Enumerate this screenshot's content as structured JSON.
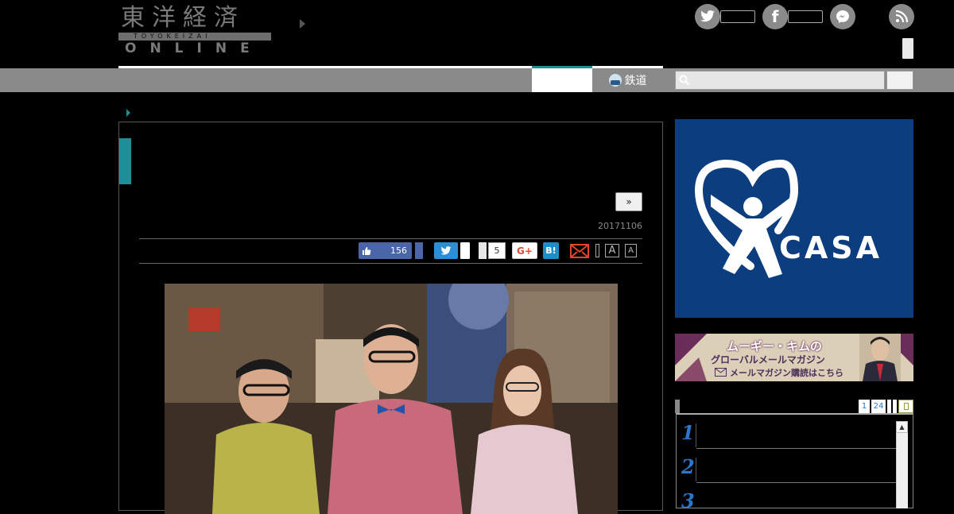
{
  "header": {
    "logo_kanji": "東洋経済",
    "logo_romaji": "TOYOKEIZAI",
    "logo_online": "ONLINE"
  },
  "social": {
    "icons": [
      "twitter-icon",
      "facebook-icon",
      "messenger-icon",
      "rss-icon"
    ],
    "twitter_glyph": "t",
    "facebook_glyph": "f"
  },
  "nav": {
    "train_label": "鉄道"
  },
  "article": {
    "next_label": "»",
    "date": "20171106",
    "share": {
      "facebook_count": "156",
      "pocket_count": "5",
      "gplus_label": "G+",
      "hatena_label": "B!",
      "font_large_label": "A",
      "font_small_label": "A"
    }
  },
  "sidebar": {
    "casa_ad": {
      "brand": "CASA",
      "reg_mark": "®"
    },
    "mail_ad": {
      "line1": "ムーギー・キムの",
      "line2": "グローバルメールマガジン",
      "line3": "メールマガジン購読はこちら"
    },
    "ranking": {
      "tabs": [
        "1",
        "24"
      ],
      "numbers": [
        "1",
        "2",
        "3"
      ]
    }
  },
  "colors": {
    "accent": "#1e8f96",
    "nav_gray": "#8a8a8a",
    "casa_blue": "#0b3d7f"
  }
}
